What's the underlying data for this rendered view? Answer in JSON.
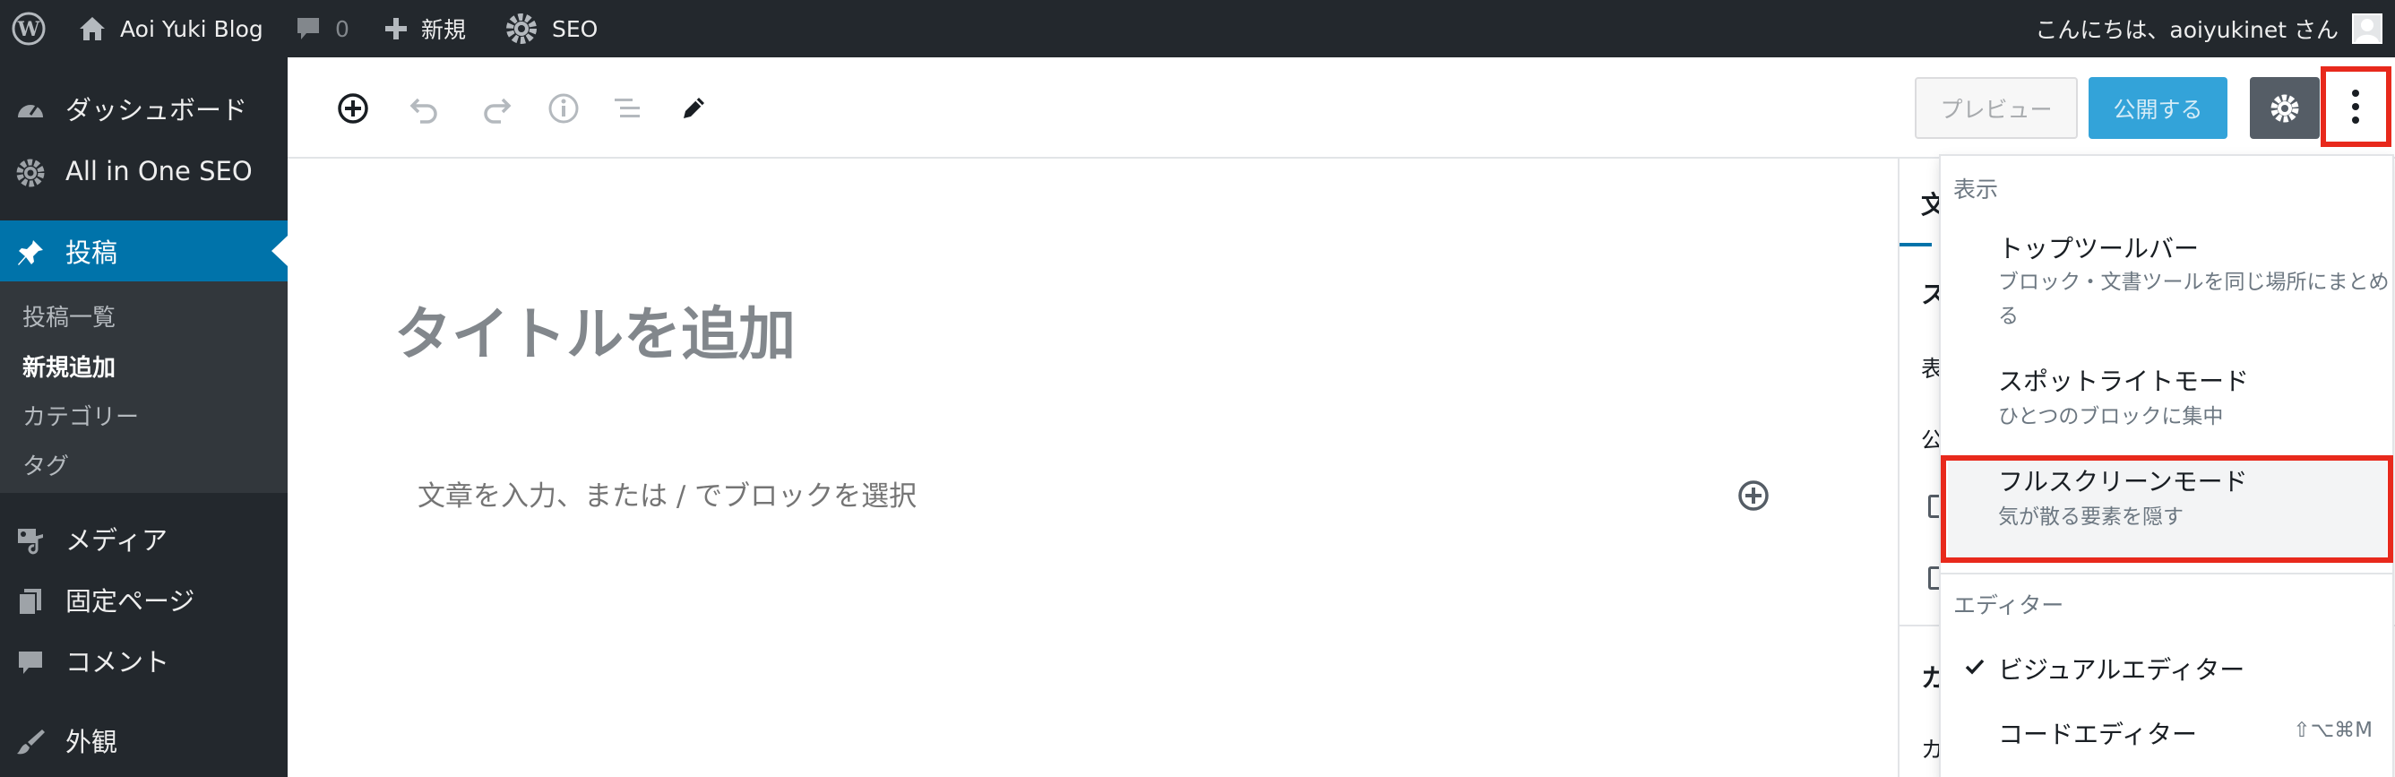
{
  "adminbar": {
    "site_name": "Aoi Yuki Blog",
    "comments_count": "0",
    "new_label": "新規",
    "seo_label": "SEO",
    "greeting": "こんにちは、aoiyukinet さん"
  },
  "menu": {
    "items": [
      {
        "label": "ダッシュボード",
        "icon": "dashboard-icon"
      },
      {
        "label": "All in One SEO",
        "icon": "gear-icon"
      },
      {
        "label": "投稿",
        "icon": "pin-icon",
        "current": true
      },
      {
        "label": "メディア",
        "icon": "media-icon"
      },
      {
        "label": "固定ページ",
        "icon": "pages-icon"
      },
      {
        "label": "コメント",
        "icon": "comment-icon"
      },
      {
        "label": "外観",
        "icon": "brush-icon"
      }
    ],
    "submenu": [
      "投稿一覧",
      "新規追加",
      "カテゴリー",
      "タグ"
    ],
    "current_submenu": "新規追加"
  },
  "toolbar": {
    "preview_label": "プレビュー",
    "publish_label": "公開する"
  },
  "editor": {
    "title_placeholder": "タイトルを追加",
    "block_placeholder": "文章を入力、または / でブロックを選択"
  },
  "sidebar_fragments": [
    "文",
    "ス",
    "表",
    "公",
    "カ",
    "カ"
  ],
  "dropdown": {
    "group_view": "表示",
    "items_view": [
      {
        "label": "トップツールバー",
        "desc": "ブロック・文書ツールを同じ場所にまとめる"
      },
      {
        "label": "スポットライトモード",
        "desc": "ひとつのブロックに集中"
      },
      {
        "label": "フルスクリーンモード",
        "desc": "気が散る要素を隠す"
      }
    ],
    "group_editor": "エディター",
    "items_editor": [
      {
        "label": "ビジュアルエディター",
        "checked": true
      },
      {
        "label": "コードエディター",
        "shortcut": "⇧⌥⌘M"
      }
    ]
  },
  "colors": {
    "admin_dark": "#23282d",
    "admin_accent": "#0073aa",
    "highlight_red": "#e8291c",
    "publish_blue": "#33a3d9"
  }
}
